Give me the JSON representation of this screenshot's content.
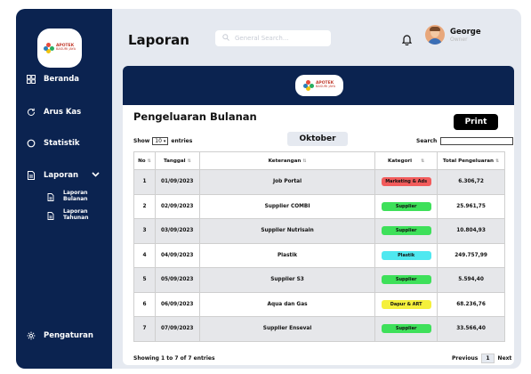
{
  "brand": {
    "line1": "APOTEK",
    "line2": "BASURI JAYA"
  },
  "sidebar": {
    "items": [
      {
        "label": "Beranda",
        "icon": "grid-icon"
      },
      {
        "label": "Arus Kas",
        "icon": "refresh-icon"
      },
      {
        "label": "Statistik",
        "icon": "circle-icon"
      },
      {
        "label": "Laporan",
        "icon": "document-icon",
        "expanded": true
      }
    ],
    "sub_items": [
      {
        "label": "Laporan Bulanan",
        "icon": "file-icon"
      },
      {
        "label": "Laporan Tahunan",
        "icon": "file-icon"
      }
    ],
    "settings_label": "Pengaturan"
  },
  "header": {
    "title": "Laporan",
    "search_placeholder": "General Search...",
    "user_name": "George",
    "user_role": "Owner"
  },
  "report": {
    "title": "Pengeluaran Bulanan",
    "print_label": "Print",
    "show_label": "Show",
    "entries_value": "10",
    "entries_label": "entries",
    "month": "Oktober",
    "search_label": "Search"
  },
  "table": {
    "columns": [
      "No",
      "Tanggal",
      "Keterangan",
      "Kategori",
      "Total Pengeluaran"
    ],
    "rows": [
      {
        "no": "1",
        "tanggal": "01/09/2023",
        "keterangan": "Job Portal",
        "kategori": "Marketing & Ads",
        "total": "6.306,72"
      },
      {
        "no": "2",
        "tanggal": "02/09/2023",
        "keterangan": "Supplier COMBI",
        "kategori": "Supplier",
        "total": "25.961,75"
      },
      {
        "no": "3",
        "tanggal": "03/09/2023",
        "keterangan": "Supplier Nutrisain",
        "kategori": "Supplier",
        "total": "10.804,93"
      },
      {
        "no": "4",
        "tanggal": "04/09/2023",
        "keterangan": "Plastik",
        "kategori": "Plastik",
        "total": "249.757,99"
      },
      {
        "no": "5",
        "tanggal": "05/09/2023",
        "keterangan": "Supplier S3",
        "kategori": "Supplier",
        "total": "5.594,40"
      },
      {
        "no": "6",
        "tanggal": "06/09/2023",
        "keterangan": "Aqua dan Gas",
        "kategori": "Dapur & ART",
        "total": "68.236,76"
      },
      {
        "no": "7",
        "tanggal": "07/09/2023",
        "keterangan": "Supplier Enseval",
        "kategori": "Supplier",
        "total": "33.566,40"
      }
    ],
    "category_colors": {
      "Marketing & Ads": "#f25c5c",
      "Supplier": "#3ee05a",
      "Plastik": "#4fe8f0",
      "Dapur & ART": "#f5f03c"
    },
    "info": "Showing 1 to 7 of 7 entries",
    "pager": {
      "previous": "Previous",
      "current": "1",
      "next": "Next"
    }
  },
  "colors": {
    "navy": "#0b2350",
    "background": "#e5e9f0"
  }
}
